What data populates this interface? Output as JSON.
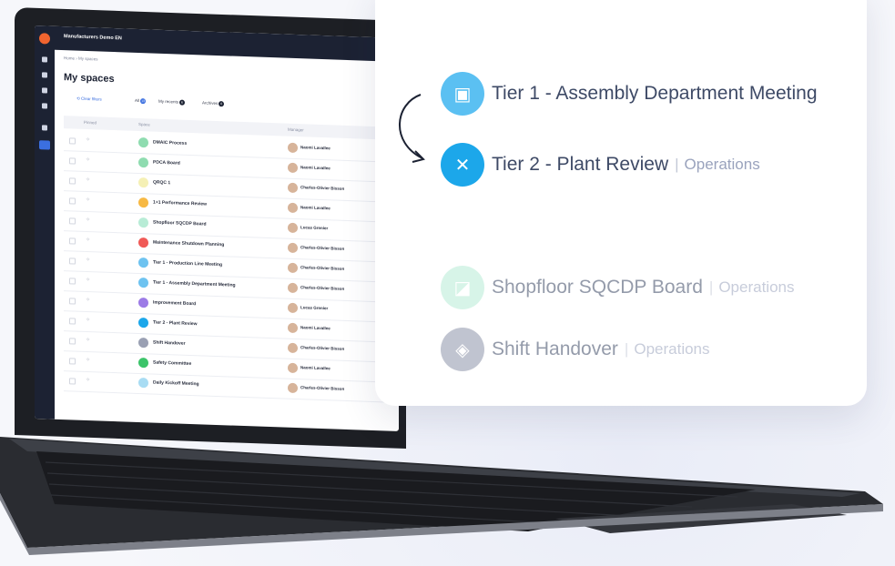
{
  "app": {
    "workspace_name": "Manufacturers Demo EN",
    "breadcrumb": [
      "Home",
      "My spaces"
    ],
    "page_title": "My spaces"
  },
  "filters": {
    "clear_label": "Clear filters",
    "all_label": "All",
    "all_count": "13",
    "recents_label": "My recents",
    "recents_count": "6",
    "archives_label": "Archives",
    "archives_count": "0"
  },
  "table": {
    "headers": {
      "pinned": "Pinned",
      "space": "Space",
      "manager": "Manager"
    },
    "rows": [
      {
        "space": "DMAIC Process",
        "manager": "Naomi Lavallee",
        "icon_color": "#8fdcb0"
      },
      {
        "space": "PDCA Board",
        "manager": "Naomi Lavallee",
        "icon_color": "#8fdcb0"
      },
      {
        "space": "QRQC 1",
        "manager": "Charles-Olivier Bisson",
        "icon_color": "#f5f0b5"
      },
      {
        "space": "1+1 Performance Review",
        "manager": "Naomi Lavallee",
        "icon_color": "#f7b944"
      },
      {
        "space": "Shopfloor SQCDP Board",
        "manager": "Lucas Grenier",
        "icon_color": "#b8ecd6"
      },
      {
        "space": "Maintenance Shutdown Planning",
        "manager": "Charles-Olivier Bisson",
        "icon_color": "#f05a57"
      },
      {
        "space": "Tier 1 - Production Line Meeting",
        "manager": "Charles-Olivier Bisson",
        "icon_color": "#6ec3f0"
      },
      {
        "space": "Tier 1 - Assembly Department Meeting",
        "manager": "Charles-Olivier Bisson",
        "icon_color": "#6ec3f0"
      },
      {
        "space": "Improvement Board",
        "manager": "Lucas Grenier",
        "icon_color": "#9c7be6"
      },
      {
        "space": "Tier 2 - Plant Review",
        "manager": "Naomi Lavallee",
        "icon_color": "#1ca7ea"
      },
      {
        "space": "Shift Handover",
        "manager": "Charles-Olivier Bisson",
        "icon_color": "#9aa0b3"
      },
      {
        "space": "Safety Committee",
        "manager": "Naomi Lavallee",
        "icon_color": "#3cc46a"
      },
      {
        "space": "Daily Kickoff Meeting",
        "manager": "Charles-Olivier Bisson",
        "icon_color": "#a8dcf3"
      }
    ]
  },
  "popup": {
    "items": [
      {
        "title": "Tier 1 - Assembly Department Meeting",
        "category": "",
        "icon": "meeting-board-icon",
        "color": "#5bc0f2"
      },
      {
        "title": "Tier 2 - Plant Review",
        "category": "Operations",
        "icon": "network-nodes-icon",
        "color": "#1ca7ea"
      },
      {
        "title": "Shopfloor SQCDP Board",
        "category": "Operations",
        "icon": "presentation-icon",
        "color": "#b8ecd6"
      },
      {
        "title": "Shift Handover",
        "category": "Operations",
        "icon": "handover-icon",
        "color": "#8e95aa"
      }
    ],
    "separator": "|"
  }
}
